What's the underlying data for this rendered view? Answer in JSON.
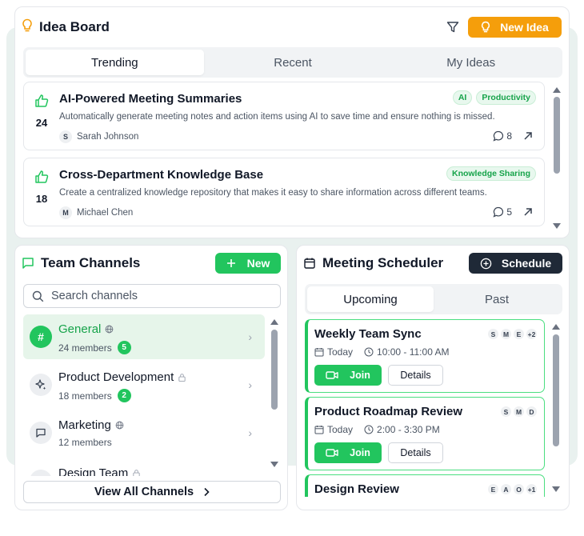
{
  "idea_board": {
    "title": "Idea Board",
    "new_idea_label": "New Idea",
    "tabs": [
      {
        "label": "Trending",
        "active": true
      },
      {
        "label": "Recent",
        "active": false
      },
      {
        "label": "My Ideas",
        "active": false
      }
    ],
    "ideas": [
      {
        "votes": "24",
        "title": "AI-Powered Meeting Summaries",
        "description": "Automatically generate meeting notes and action items using AI to save time and ensure nothing is missed.",
        "author_initial": "S",
        "author": "Sarah Johnson",
        "tags": [
          "AI",
          "Productivity"
        ],
        "comments": "8"
      },
      {
        "votes": "18",
        "title": "Cross-Department Knowledge Base",
        "description": "Create a centralized knowledge repository that makes it easy to share information across different teams.",
        "author_initial": "M",
        "author": "Michael Chen",
        "tags": [
          "Knowledge Sharing"
        ],
        "comments": "5"
      }
    ]
  },
  "team_channels": {
    "title": "Team Channels",
    "new_label": "New",
    "search_placeholder": "Search channels",
    "channels": [
      {
        "icon": "#",
        "name": "General",
        "visibility": "public",
        "members": "24 members",
        "unread": "5",
        "active": true
      },
      {
        "icon": "sparkle-icon",
        "name": "Product Development",
        "visibility": "private",
        "members": "18 members",
        "unread": "2",
        "active": false
      },
      {
        "icon": "chat-icon",
        "name": "Marketing",
        "visibility": "public",
        "members": "12 members",
        "unread": "",
        "active": false
      },
      {
        "icon": "chat-icon",
        "name": "Design Team",
        "visibility": "private",
        "members": "",
        "unread": "",
        "active": false
      }
    ],
    "view_all_label": "View All Channels"
  },
  "meeting_scheduler": {
    "title": "Meeting Scheduler",
    "schedule_label": "Schedule",
    "tabs": [
      {
        "label": "Upcoming",
        "active": true
      },
      {
        "label": "Past",
        "active": false
      }
    ],
    "meetings": [
      {
        "title": "Weekly Team Sync",
        "day": "Today",
        "time": "10:00 - 11:00 AM",
        "attendees": [
          "S",
          "M",
          "E"
        ],
        "more": "+2"
      },
      {
        "title": "Product Roadmap Review",
        "day": "Today",
        "time": "2:00 - 3:30 PM",
        "attendees": [
          "S",
          "M",
          "D"
        ],
        "more": ""
      },
      {
        "title": "Design Review",
        "day": "",
        "time": "",
        "attendees": [
          "E",
          "A",
          "O"
        ],
        "more": "+1"
      }
    ],
    "join_label": "Join",
    "details_label": "Details"
  },
  "colors": {
    "accent_green": "#22c55e",
    "accent_orange": "#f59e0b",
    "dark_button": "#1f2937"
  }
}
